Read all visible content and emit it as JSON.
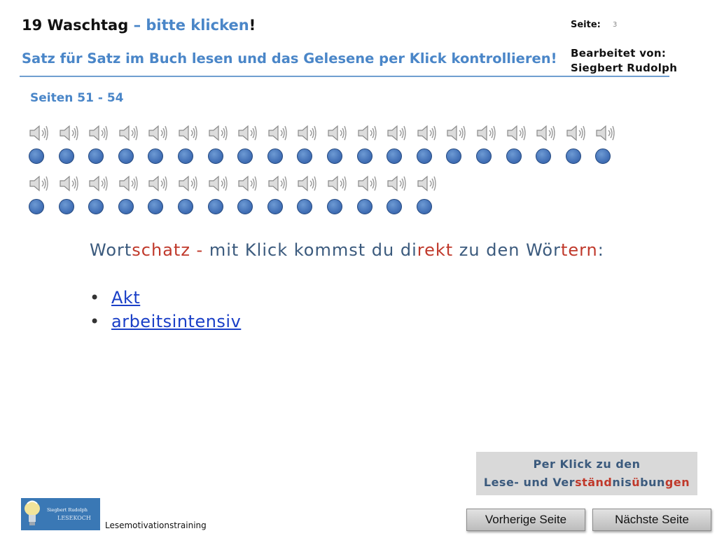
{
  "header": {
    "title_prefix": "19 Waschtag",
    "title_dash": " – ",
    "title_click": "bitte klicken",
    "title_suffix": "!",
    "subtitle": "Satz für Satz im Buch lesen und das Gelesene per Klick kontrollieren!",
    "page_label": "Seite:",
    "page_number": "3",
    "edited_by_label": "Bearbeitet von:",
    "edited_by_name": "Siegbert Rudolph",
    "pages_range": "Seiten 51 - 54"
  },
  "audio": {
    "row1_count": 20,
    "row2_count": 14,
    "speaker_icon": "speaker-icon",
    "button_color": "#4472b8"
  },
  "vocabulary": {
    "heading_parts": [
      {
        "text": "Wort",
        "color": "normal"
      },
      {
        "text": "schatz",
        "color": "red"
      },
      {
        "text": " - ",
        "color": "red"
      },
      {
        "text": "mit Klick kommst du di",
        "color": "normal"
      },
      {
        "text": "rekt",
        "color": "red"
      },
      {
        "text": " zu den Wör",
        "color": "normal"
      },
      {
        "text": "tern",
        "color": "red"
      },
      {
        "text": ":",
        "color": "normal"
      }
    ],
    "words": [
      "Akt",
      "arbeitsintensiv"
    ]
  },
  "exercise_link": {
    "line1": "Per Klick zu den",
    "line2_parts": [
      {
        "text": "Lese- und Ver",
        "color": "normal"
      },
      {
        "text": "ständ",
        "color": "red"
      },
      {
        "text": "nis",
        "color": "normal"
      },
      {
        "text": "ü",
        "color": "red"
      },
      {
        "text": "bun",
        "color": "normal"
      },
      {
        "text": "gen",
        "color": "red"
      }
    ]
  },
  "navigation": {
    "prev_label": "Vorherige Seite",
    "next_label": "Nächste Seite"
  },
  "footer": {
    "logo_text_top": "Siegbert Rudolph",
    "logo_text_bottom": "LESEKOCH",
    "program_name": "Lesemotivationstraining"
  },
  "colors": {
    "accent_blue": "#4a86c8",
    "highlight_red": "#c0392b",
    "link_blue": "#1a3fc7"
  }
}
